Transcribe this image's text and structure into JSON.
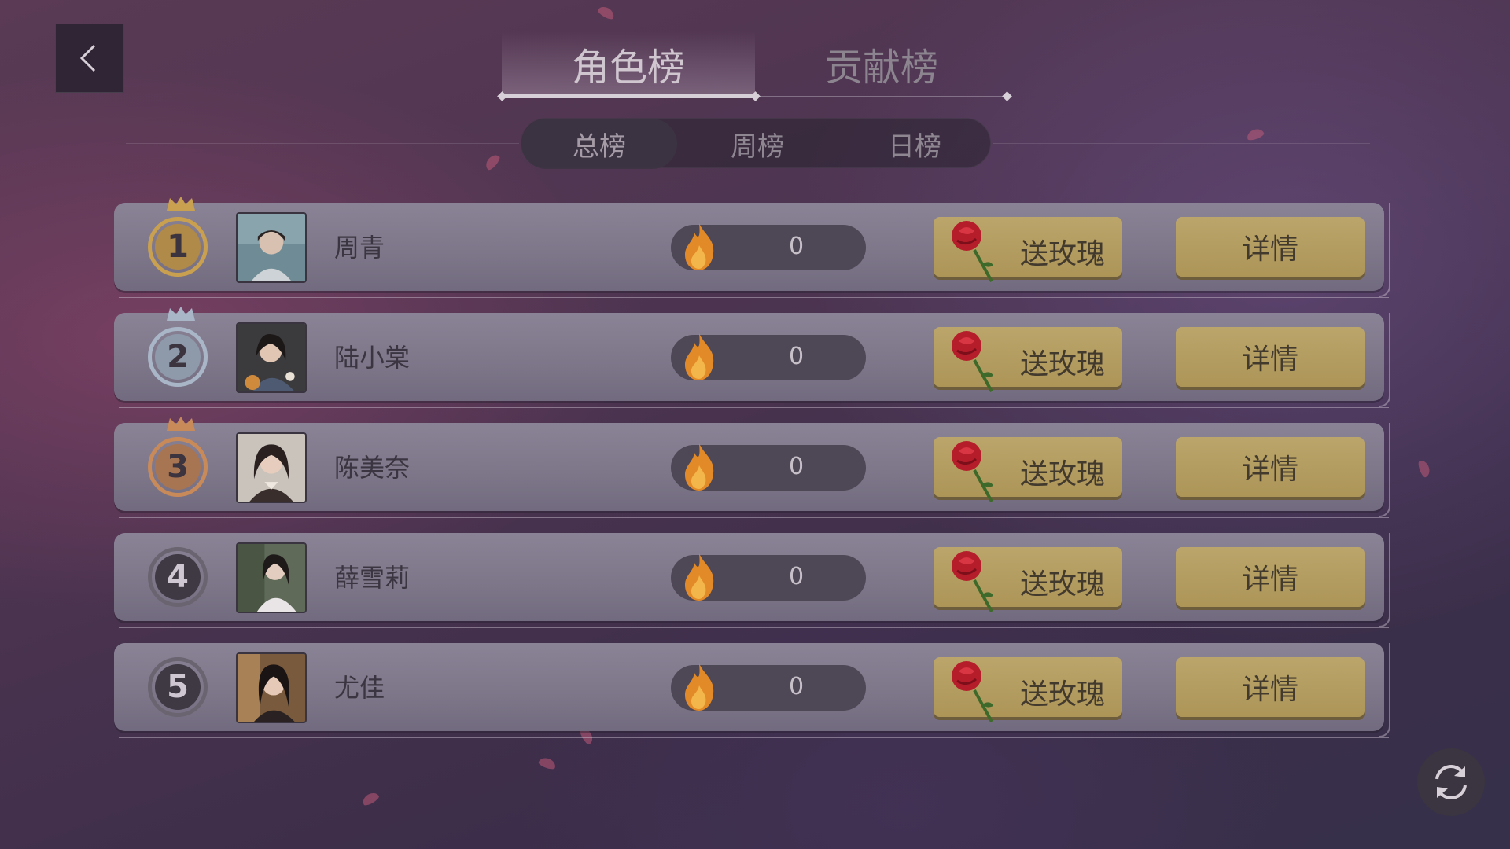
{
  "header": {
    "tabs": [
      {
        "label": "角色榜",
        "active": true
      },
      {
        "label": "贡献榜",
        "active": false
      }
    ],
    "sub_tabs": [
      {
        "label": "总榜",
        "active": true
      },
      {
        "label": "周榜",
        "active": false
      },
      {
        "label": "日榜",
        "active": false
      }
    ]
  },
  "ranking": {
    "send_rose_label": "送玫瑰",
    "detail_label": "详情",
    "rows": [
      {
        "rank": "1",
        "name": "周青",
        "heat": "0",
        "medal": "gold"
      },
      {
        "rank": "2",
        "name": "陆小棠",
        "heat": "0",
        "medal": "silver"
      },
      {
        "rank": "3",
        "name": "陈美奈",
        "heat": "0",
        "medal": "bronze"
      },
      {
        "rank": "4",
        "name": "薛雪莉",
        "heat": "0",
        "medal": "plain"
      },
      {
        "rank": "5",
        "name": "尤佳",
        "heat": "0",
        "medal": "plain"
      }
    ]
  },
  "colors": {
    "gold": "#c9a04f",
    "silver": "#a9b6c8",
    "bronze": "#c98a5a",
    "plain": "#6a6470",
    "button_gold": "#b39d60"
  },
  "icons": {
    "back": "chevron-left-icon",
    "heat": "flame-icon",
    "rose": "rose-icon",
    "refresh": "refresh-icon"
  }
}
